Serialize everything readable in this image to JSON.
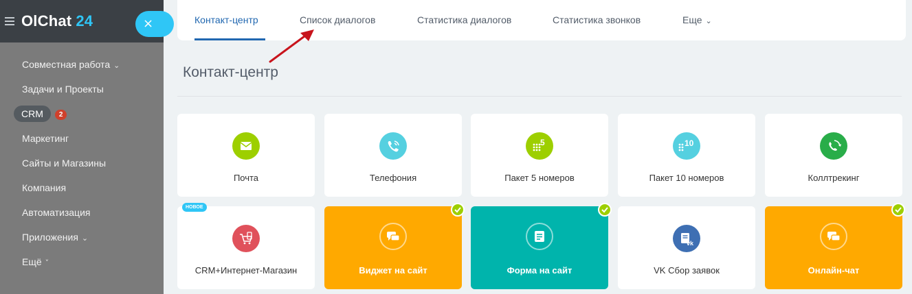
{
  "app": {
    "logo_name": "OlChat",
    "logo_number": "24",
    "close_glyph": "×"
  },
  "sidebar": {
    "items": [
      {
        "label": "Совместная работа",
        "chevron": "⌄"
      },
      {
        "label": "Задачи и Проекты"
      },
      {
        "label": "CRM",
        "count": "2"
      },
      {
        "label": "Маркетинг"
      },
      {
        "label": "Сайты и Магазины"
      },
      {
        "label": "Компания"
      },
      {
        "label": "Автоматизация"
      },
      {
        "label": "Приложения",
        "chevron": "⌄"
      },
      {
        "label": "Ещё",
        "chevron": "˅"
      }
    ]
  },
  "tabs": {
    "items": [
      {
        "label": "Контакт-центр",
        "active": true
      },
      {
        "label": "Список диалогов"
      },
      {
        "label": "Статистика диалогов"
      },
      {
        "label": "Статистика звонков"
      },
      {
        "label": "Еще",
        "chevron": "⌄"
      }
    ]
  },
  "page": {
    "title": "Контакт-центр"
  },
  "tiles": [
    {
      "label": "Почта",
      "icon": "mail-icon",
      "color": "#9dcf00"
    },
    {
      "label": "Телефония",
      "icon": "phone-icon",
      "color": "#55d0e0"
    },
    {
      "label": "Пакет 5 номеров",
      "icon": "keypad-5-icon",
      "color": "#9dcf00",
      "icon_text": "5"
    },
    {
      "label": "Пакет 10 номеров",
      "icon": "keypad-10-icon",
      "color": "#55d0e0",
      "icon_text": "10"
    },
    {
      "label": "Коллтрекинг",
      "icon": "calltracking-icon",
      "color": "#29ad49"
    },
    {
      "label": "CRM+Интернет-Магазин",
      "icon": "shop-cart-icon",
      "color": "#e0515b",
      "badge": "НОВОЕ"
    },
    {
      "label": "Виджет на сайт",
      "icon": "chat-bubbles-icon",
      "color": "#ffa900",
      "checked": true
    },
    {
      "label": "Форма на сайт",
      "icon": "form-icon",
      "color": "#00b4ac",
      "checked": true
    },
    {
      "label": "VK Сбор заявок",
      "icon": "vk-form-icon",
      "color": "#3e6fb3"
    },
    {
      "label": "Онлайн-чат",
      "icon": "chat-bubbles-icon",
      "color": "#ffa900",
      "checked": true
    }
  ]
}
